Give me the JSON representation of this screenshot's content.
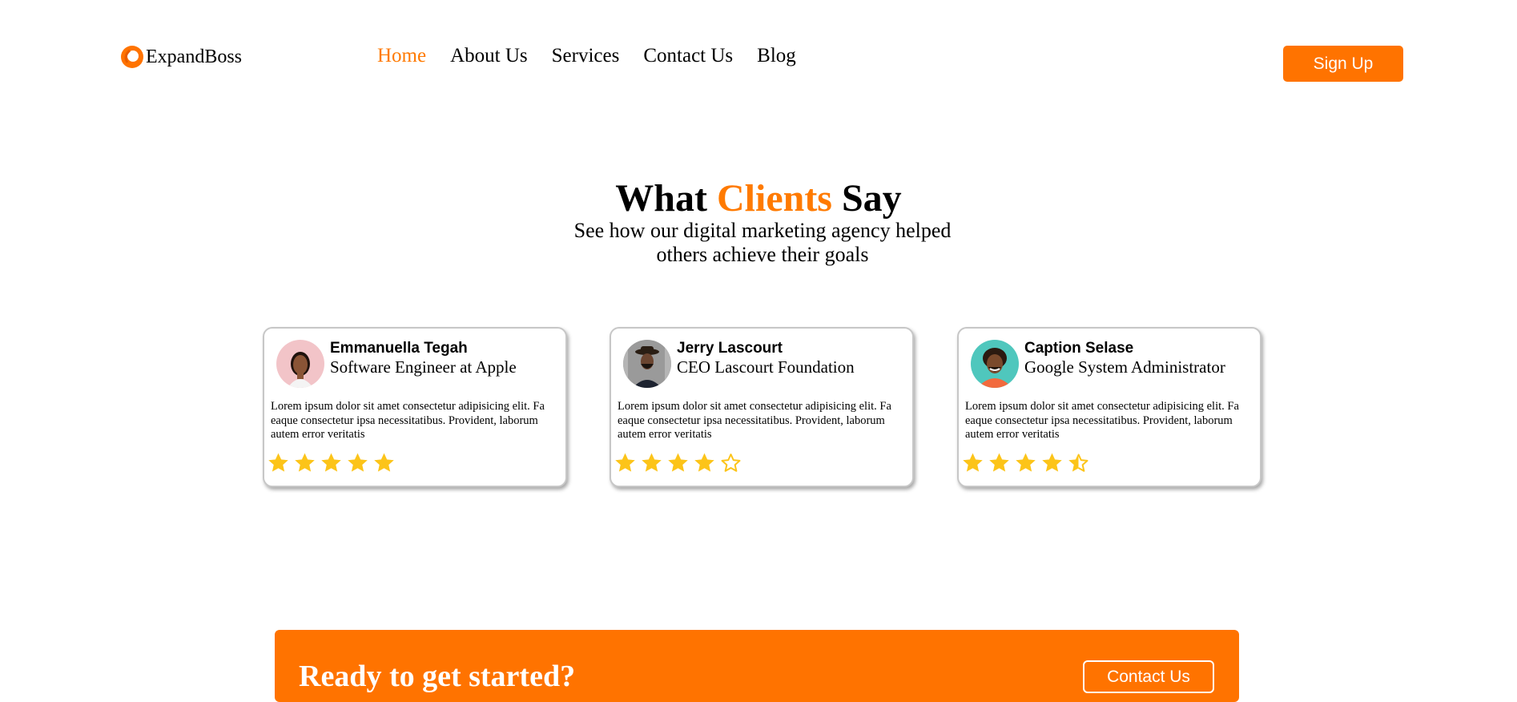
{
  "header": {
    "logo_text": "ExpandBoss",
    "nav": [
      {
        "label": "Home",
        "active": true
      },
      {
        "label": "About Us"
      },
      {
        "label": "Services"
      },
      {
        "label": "Contact Us"
      },
      {
        "label": "Blog"
      }
    ],
    "signup_label": "Sign Up"
  },
  "testimonials": {
    "title_part1": "What",
    "title_accent": "Clients",
    "title_part2": "Say",
    "subtitle": "See how our digital marketing agency helped others achieve their goals",
    "cards": [
      {
        "name": "Emmanuella Tegah",
        "role": "Software Engineer at Apple",
        "text": "Lorem ipsum dolor sit amet consectetur adipisicing elit. Fa eaque consectetur ipsa necessitatibus. Provident, laborum autem error veritatis",
        "rating": 5
      },
      {
        "name": "Jerry Lascourt",
        "role": "CEO Lascourt Foundation",
        "text": "Lorem ipsum dolor sit amet consectetur adipisicing elit. Fa eaque consectetur ipsa necessitatibus. Provident, laborum autem error veritatis",
        "rating": 4
      },
      {
        "name": "Caption Selase",
        "role": "Google System Administrator",
        "text": "Lorem ipsum dolor sit amet consectetur adipisicing elit. Fa eaque consectetur ipsa necessitatibus. Provident, laborum autem error veritatis",
        "rating": 4.5
      }
    ]
  },
  "cta": {
    "title": "Ready to get started?",
    "button_label": "Contact Us"
  },
  "colors": {
    "accent": "#ff7a00",
    "button": "#ff7300",
    "star": "#fcc419"
  }
}
